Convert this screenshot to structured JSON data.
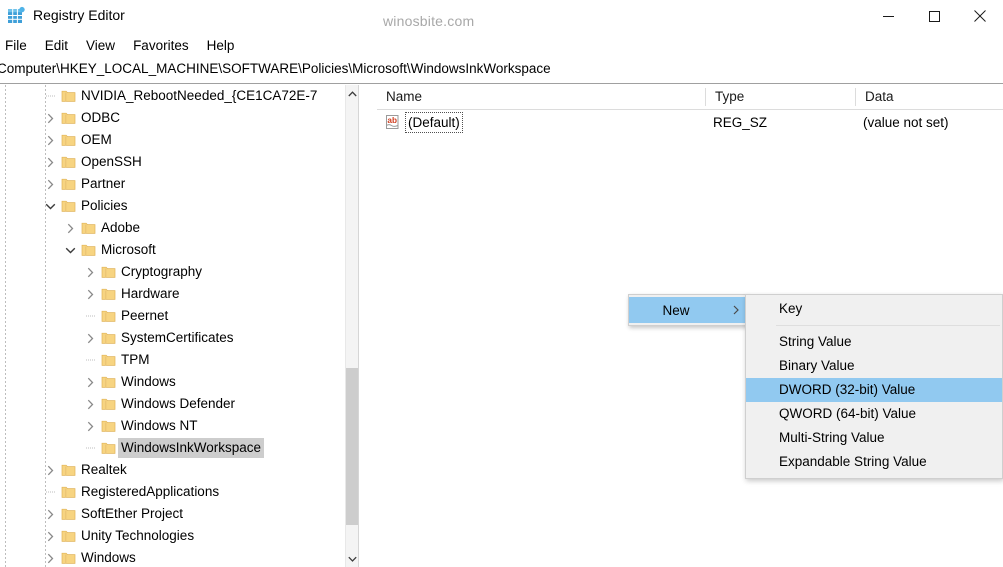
{
  "window": {
    "title": "Registry Editor",
    "app_icon": "registry-editor-icon",
    "watermark": "winosbite.com",
    "controls": {
      "minimize": "minimize-icon",
      "maximize": "maximize-icon",
      "close": "close-icon"
    }
  },
  "menubar": {
    "items": [
      {
        "label": "File"
      },
      {
        "label": "Edit"
      },
      {
        "label": "View"
      },
      {
        "label": "Favorites"
      },
      {
        "label": "Help"
      }
    ]
  },
  "address": {
    "path": "Computer\\HKEY_LOCAL_MACHINE\\SOFTWARE\\Policies\\Microsoft\\WindowsInkWorkspace"
  },
  "tree": {
    "scrollbar": {
      "up_icon": "chevron-up-icon",
      "down_icon": "chevron-down-icon"
    },
    "nodes": [
      {
        "label": "NVIDIA_RebootNeeded_{CE1CA72E-7",
        "depth": 1,
        "expander": "none",
        "selected": false
      },
      {
        "label": "ODBC",
        "depth": 1,
        "expander": "collapsed",
        "selected": false
      },
      {
        "label": "OEM",
        "depth": 1,
        "expander": "collapsed",
        "selected": false
      },
      {
        "label": "OpenSSH",
        "depth": 1,
        "expander": "collapsed",
        "selected": false
      },
      {
        "label": "Partner",
        "depth": 1,
        "expander": "collapsed",
        "selected": false
      },
      {
        "label": "Policies",
        "depth": 1,
        "expander": "expanded",
        "selected": false
      },
      {
        "label": "Adobe",
        "depth": 2,
        "expander": "collapsed",
        "selected": false
      },
      {
        "label": "Microsoft",
        "depth": 2,
        "expander": "expanded",
        "selected": false
      },
      {
        "label": "Cryptography",
        "depth": 3,
        "expander": "collapsed",
        "selected": false
      },
      {
        "label": "Hardware",
        "depth": 3,
        "expander": "collapsed",
        "selected": false
      },
      {
        "label": "Peernet",
        "depth": 3,
        "expander": "none",
        "selected": false
      },
      {
        "label": "SystemCertificates",
        "depth": 3,
        "expander": "collapsed",
        "selected": false
      },
      {
        "label": "TPM",
        "depth": 3,
        "expander": "none",
        "selected": false
      },
      {
        "label": "Windows",
        "depth": 3,
        "expander": "collapsed",
        "selected": false
      },
      {
        "label": "Windows Defender",
        "depth": 3,
        "expander": "collapsed",
        "selected": false
      },
      {
        "label": "Windows NT",
        "depth": 3,
        "expander": "collapsed",
        "selected": false
      },
      {
        "label": "WindowsInkWorkspace",
        "depth": 3,
        "expander": "none",
        "selected": true
      },
      {
        "label": "Realtek",
        "depth": 1,
        "expander": "collapsed",
        "selected": false
      },
      {
        "label": "RegisteredApplications",
        "depth": 1,
        "expander": "none",
        "selected": false
      },
      {
        "label": "SoftEther Project",
        "depth": 1,
        "expander": "collapsed",
        "selected": false
      },
      {
        "label": "Unity Technologies",
        "depth": 1,
        "expander": "collapsed",
        "selected": false
      },
      {
        "label": "Windows",
        "depth": 1,
        "expander": "collapsed",
        "selected": false
      }
    ]
  },
  "list": {
    "columns": [
      {
        "label": "Name"
      },
      {
        "label": "Type"
      },
      {
        "label": "Data"
      }
    ],
    "rows": [
      {
        "icon": "string-value-icon",
        "name": "(Default)",
        "type": "REG_SZ",
        "data": "(value not set)"
      }
    ]
  },
  "context_menu": {
    "parent": {
      "label": "New",
      "submenu_arrow": "chevron-right-icon",
      "highlight_color": "#91c9f0"
    },
    "items": [
      {
        "label": "Key",
        "highlighted": false
      },
      {
        "separator": true
      },
      {
        "label": "String Value",
        "highlighted": false
      },
      {
        "label": "Binary Value",
        "highlighted": false
      },
      {
        "label": "DWORD (32-bit) Value",
        "highlighted": true
      },
      {
        "label": "QWORD (64-bit) Value",
        "highlighted": false
      },
      {
        "label": "Multi-String Value",
        "highlighted": false
      },
      {
        "label": "Expandable String Value",
        "highlighted": false
      }
    ]
  },
  "colors": {
    "selection_blue": "#91c9f0",
    "tree_selection_gray": "#cdcdcd",
    "folder_yellow": "#f7d481"
  }
}
